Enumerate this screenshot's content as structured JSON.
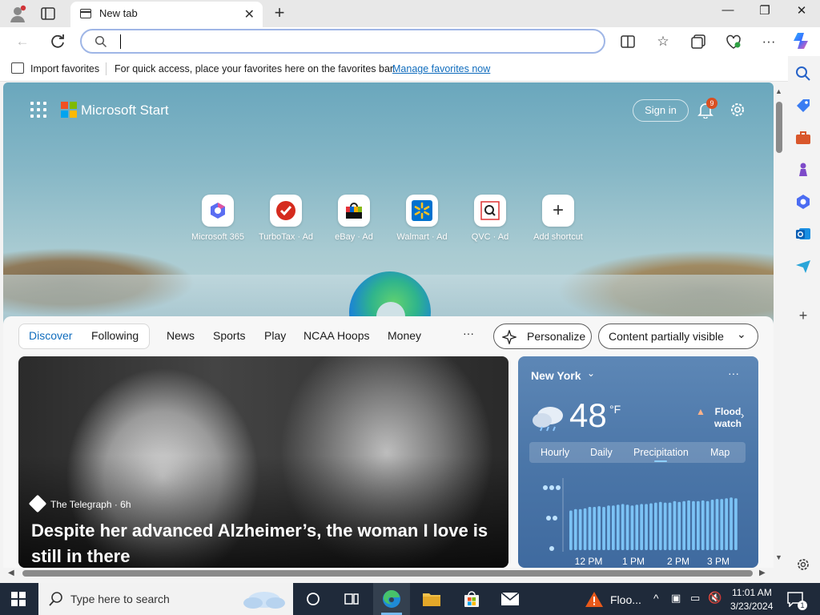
{
  "tab": {
    "title": "New tab"
  },
  "window": {
    "minimize": "—",
    "restore": "❐",
    "close": "✕"
  },
  "favorites_bar": {
    "import_label": "Import favorites",
    "message": "For quick access, place your favorites here on the favorites bar.",
    "manage_link": "Manage favorites now"
  },
  "start_page": {
    "brand": "Microsoft Start",
    "sign_in": "Sign in",
    "notification_count": "9",
    "shortcuts": [
      {
        "label": "Microsoft 365",
        "icon": "microsoft-365-icon"
      },
      {
        "label": "TurboTax · Ad",
        "icon": "turbotax-icon"
      },
      {
        "label": "eBay · Ad",
        "icon": "ebay-icon"
      },
      {
        "label": "Walmart · Ad",
        "icon": "walmart-icon"
      },
      {
        "label": "QVC · Ad",
        "icon": "qvc-icon"
      },
      {
        "label": "Add shortcut",
        "icon": "plus-icon"
      }
    ]
  },
  "feed_nav": {
    "discover": "Discover",
    "following": "Following",
    "items": [
      "News",
      "Sports",
      "Play",
      "NCAA Hoops",
      "Money"
    ],
    "more": "···",
    "personalize": "Personalize",
    "content_visibility": "Content partially visible"
  },
  "hero_article": {
    "source": "The Telegraph · 6h",
    "headline": "Despite her advanced Alzheimer’s, the woman I love is still in there"
  },
  "weather": {
    "city": "New York",
    "temperature": "48",
    "unit": "°F",
    "alert": "Flood watch",
    "tabs": [
      "Hourly",
      "Daily",
      "Precipitation",
      "Map"
    ],
    "selected_tab": "Precipitation",
    "time_labels": [
      "12 PM",
      "1 PM",
      "2 PM",
      "3 PM"
    ],
    "precip_bars": [
      0.55,
      0.57,
      0.57,
      0.58,
      0.6,
      0.6,
      0.61,
      0.6,
      0.62,
      0.62,
      0.63,
      0.64,
      0.63,
      0.62,
      0.63,
      0.64,
      0.64,
      0.65,
      0.66,
      0.67,
      0.66,
      0.66,
      0.68,
      0.67,
      0.68,
      0.69,
      0.68,
      0.68,
      0.69,
      0.68,
      0.7,
      0.71,
      0.71,
      0.72,
      0.73,
      0.72
    ]
  },
  "taskbar": {
    "search_placeholder": "Type here to search",
    "weather_alert": "Floo...",
    "time": "11:01 AM",
    "date": "3/23/2024",
    "notification_count": "1"
  },
  "colors": {
    "accent": "#0f6cbd",
    "taskbar": "#1f2a3a",
    "badge": "#d94f21",
    "weather_bar": "#7cc3f5"
  }
}
